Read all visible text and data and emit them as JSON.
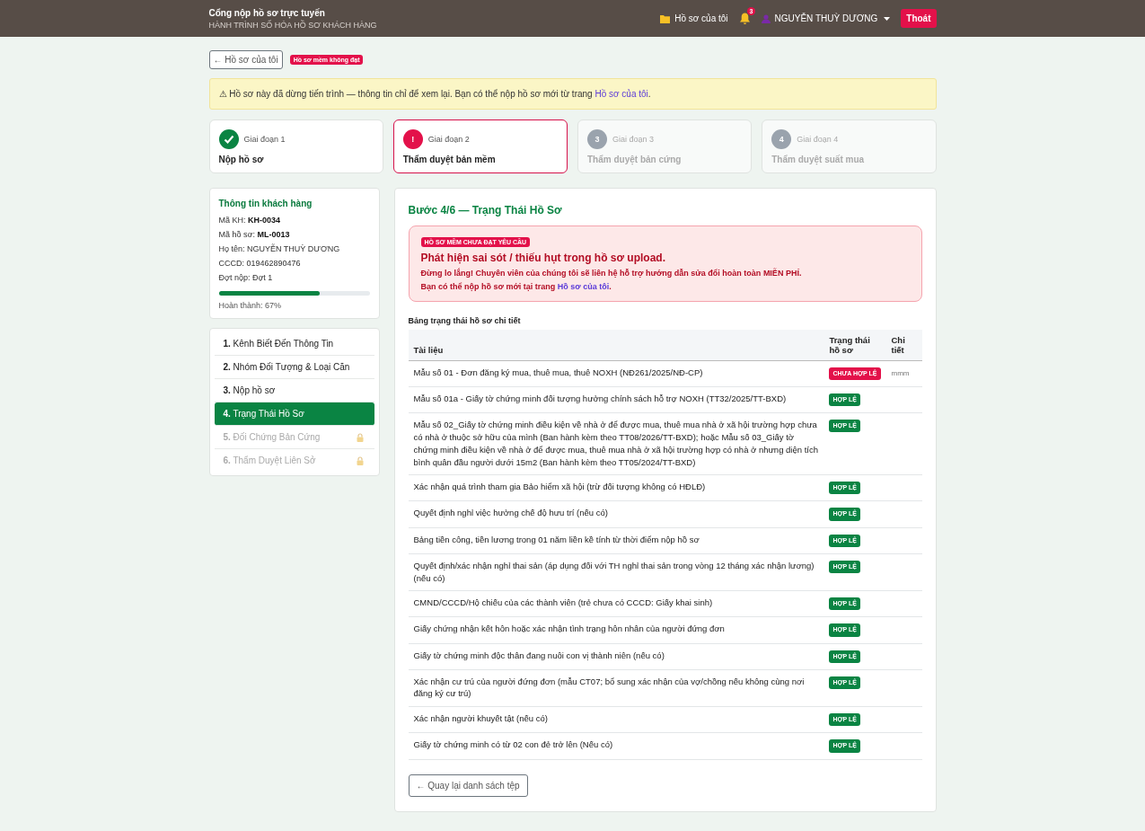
{
  "header": {
    "title": "Cổng nộp hồ sơ trực tuyến",
    "subtitle": "HÀNH TRÌNH SỐ HÓA HỒ SƠ KHÁCH HÀNG",
    "my_files": "Hồ sơ của tôi",
    "notifications": "3",
    "user": "NGUYỄN THUỲ DƯƠNG",
    "logout": "Thoát"
  },
  "back_button": "← Hồ sơ của tôi",
  "status_badge": "Hồ sơ mềm không đạt",
  "notice": {
    "text": "⚠ Hồ sơ này đã dừng tiến trình — thông tin chỉ để xem lại. Bạn có thể nộp hồ sơ mới từ trang ",
    "link": "Hồ sơ của tôi",
    "end": "."
  },
  "stages": [
    {
      "kind": "done",
      "label": "Giai đoạn 1",
      "title": "Nộp hồ sơ"
    },
    {
      "kind": "current",
      "badge": "!",
      "label": "Giai đoạn 2",
      "title": "Thẩm duyệt bản mềm"
    },
    {
      "kind": "locked",
      "badge": "3",
      "label": "Giai đoạn 3",
      "title": "Thẩm duyệt bản cứng"
    },
    {
      "kind": "locked",
      "badge": "4",
      "label": "Giai đoạn 4",
      "title": "Thẩm duyệt suất mua"
    }
  ],
  "customer": {
    "title": "Thông tin khách hàng",
    "fields": [
      {
        "label": "Mã KH: ",
        "value": "KH-0034",
        "bold": true
      },
      {
        "label": "Mã hồ sơ: ",
        "value": "ML-0013",
        "bold": true
      },
      {
        "label": "Họ tên: ",
        "value": "NGUYỄN THUỲ DƯƠNG",
        "bold": false
      },
      {
        "label": "CCCD: ",
        "value": "019462890476",
        "bold": false
      },
      {
        "label": "Đợt nộp: ",
        "value": "Đợt 1",
        "bold": false
      }
    ],
    "level": 0.67,
    "progress_label": "Hoàn thành: 67%"
  },
  "steps": [
    {
      "number": "1.",
      "label": "Kênh Biết Đến Thông Tin",
      "selected": false,
      "disabled": false
    },
    {
      "number": "2.",
      "label": "Nhóm Đối Tượng & Loại Căn",
      "selected": false,
      "disabled": false
    },
    {
      "number": "3.",
      "label": "Nộp hồ sơ",
      "selected": false,
      "disabled": false
    },
    {
      "number": "4.",
      "label": "Trạng Thái Hồ Sơ",
      "selected": true,
      "disabled": false
    },
    {
      "number": "5.",
      "label": "Đối Chứng Bản Cứng",
      "selected": false,
      "disabled": true
    },
    {
      "number": "6.",
      "label": "Thẩm Duyệt Liên Sở",
      "selected": false,
      "disabled": true
    }
  ],
  "main": {
    "title": "Bước 4/6 — Trạng Thái Hồ Sơ",
    "alert": {
      "badge": "HỒ SƠ MỀM CHƯA ĐẠT YÊU CẦU",
      "heading": "Phát hiện sai sót / thiếu hụt trong hồ sơ upload.",
      "message": "Đừng lo lắng! Chuyên viên của chúng tôi sẽ liên hệ hỗ trợ hướng dẫn sửa đổi hoàn toàn **MIỄN PHÍ**.",
      "link_prefix": "Bạn có thể nộp hồ sơ mới tại trang ",
      "link": "Hồ sơ của tôi",
      "link_suffix": "."
    },
    "table_title": "Bảng trạng thái hồ sơ chi tiết",
    "columns": [
      "Tài liệu",
      "Trạng thái hồ sơ",
      "Chi tiết"
    ],
    "rows": [
      {
        "document": "Mẫu số 01 - Đơn đăng ký mua, thuê mua, thuê NOXH (NĐ261/2025/NĐ-CP)",
        "kind": "invalid",
        "status": "CHƯA HỢP LỆ",
        "detail": "mmm"
      },
      {
        "document": "Mẫu số 01a - Giấy tờ chứng minh đối tượng hưởng chính sách hỗ trợ NOXH (TT32/2025/TT-BXD)",
        "kind": "valid",
        "status": "HỢP LỆ"
      },
      {
        "document": "Mẫu số 02_Giấy tờ chứng minh điều kiện về nhà ở để được mua, thuê mua nhà ở xã hội trường hợp chưa có nhà ở thuộc sở hữu của mình (Ban hành kèm theo TT08/2026/TT-BXD); hoặc Mẫu số 03_Giấy tờ chứng minh điều kiện về nhà ở để được mua, thuê mua nhà ở xã hội trường hợp có nhà ở nhưng diện tích bình quân đầu người dưới 15m2 (Ban hành kèm theo TT05/2024/TT-BXD)",
        "kind": "valid",
        "status": "HỢP LỆ"
      },
      {
        "document": "Xác nhận quá trình tham gia Bảo hiểm xã hội (trừ đối tượng không có HĐLĐ)",
        "kind": "valid",
        "status": "HỢP LỆ"
      },
      {
        "document": "Quyết định nghỉ việc hưởng chế độ hưu trí (nếu có)",
        "kind": "valid",
        "status": "HỢP LỆ"
      },
      {
        "document": "Bảng tiền công, tiền lương trong 01 năm liền kề tính từ thời điểm nộp hồ sơ",
        "kind": "valid",
        "status": "HỢP LỆ"
      },
      {
        "document": "Quyết định/xác nhận nghỉ thai sản (áp dụng đối với TH nghỉ thai sản trong vòng 12 tháng xác nhận lương) (nếu có)",
        "kind": "valid",
        "status": "HỢP LỆ"
      },
      {
        "document": "CMND/CCCD/Hộ chiếu của các thành viên (trẻ chưa có CCCD: Giấy khai sinh)",
        "kind": "valid",
        "status": "HỢP LỆ"
      },
      {
        "document": "Giấy chứng nhận kết hôn hoặc xác nhận tình trạng hôn nhân của người đứng đơn",
        "kind": "valid",
        "status": "HỢP LỆ"
      },
      {
        "document": "Giấy tờ chứng minh độc thân đang nuôi con vị thành niên (nếu có)",
        "kind": "valid",
        "status": "HỢP LỆ"
      },
      {
        "document": "Xác nhận cư trú của người đứng đơn (mẫu CT07; bổ sung xác nhận của vợ/chồng nếu không cùng nơi đăng ký cư trú)",
        "kind": "valid",
        "status": "HỢP LỆ"
      },
      {
        "document": "Xác nhận người khuyết tật (nếu có)",
        "kind": "valid",
        "status": "HỢP LỆ"
      },
      {
        "document": "Giấy tờ chứng minh có từ 02 con đẻ trở lên (Nếu có)",
        "kind": "valid",
        "status": "HỢP LỆ"
      }
    ],
    "back_button": "← Quay lại danh sách tệp"
  }
}
